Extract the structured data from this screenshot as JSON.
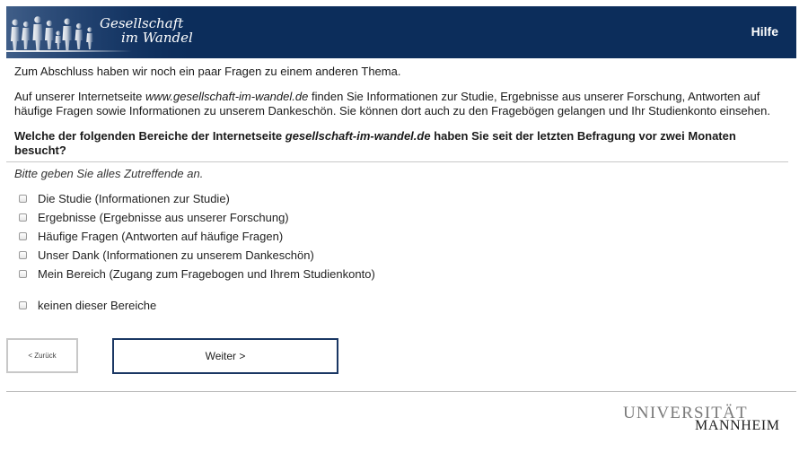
{
  "header": {
    "logo_line1": "Gesellschaft",
    "logo_line2": "im Wandel",
    "help_label": "Hilfe",
    "background_color": "#0c2d5b"
  },
  "content": {
    "intro": "Zum Abschluss haben wir noch ein paar Fragen zu einem anderen Thema.",
    "info_before": "Auf unserer Internetseite ",
    "info_site": "www.gesellschaft-im-wandel.de",
    "info_after": " finden Sie Informationen zur Studie, Ergebnisse aus unserer Forschung, Antworten auf häufige Fragen sowie Informationen zu unserem Dankeschön. Sie können dort auch zu den Fragebögen gelangen und Ihr Studienkonto einsehen.",
    "question_before": "Welche der folgenden Bereiche der Internetseite ",
    "question_site": "gesellschaft-im-wandel.de",
    "question_after": " haben Sie seit der letzten Befragung vor zwei Monaten besucht?",
    "instruction": "Bitte geben Sie alles Zutreffende an."
  },
  "options": [
    {
      "label": "Die Studie (Informationen zur Studie)",
      "checked": false
    },
    {
      "label": "Ergebnisse (Ergebnisse aus unserer Forschung)",
      "checked": false
    },
    {
      "label": "Häufige Fragen (Antworten auf häufige Fragen)",
      "checked": false
    },
    {
      "label": "Unser Dank (Informationen zu unserem Dankeschön)",
      "checked": false
    },
    {
      "label": "Mein Bereich (Zugang zum Fragebogen und Ihrem Studienkonto)",
      "checked": false
    }
  ],
  "none_option": {
    "label": "keinen dieser Bereiche",
    "checked": false
  },
  "navigation": {
    "back_label": "< Zurück",
    "next_label": "Weiter >"
  },
  "footer": {
    "university_line1": "UNIVERSITÄT",
    "university_line2": "MANNHEIM"
  }
}
